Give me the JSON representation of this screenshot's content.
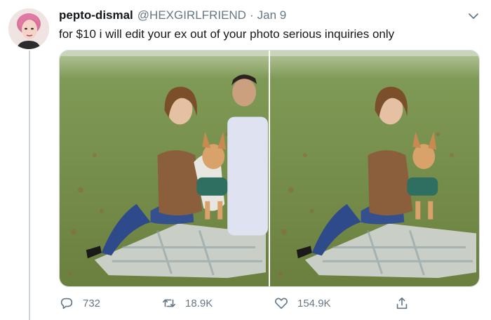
{
  "tweet": {
    "display_name": "pepto-dismal",
    "handle": "@HEXGIRLFRIEND",
    "separator": "·",
    "date": "Jan 9",
    "text": "for $10 i will edit your ex out of your photo serious inquiries only"
  },
  "media": {
    "photos": [
      {
        "label": "original photo with couple and dog"
      },
      {
        "label": "edited photo with woman and dog"
      }
    ]
  },
  "actions": {
    "reply_count": "732",
    "retweet_count": "18.9K",
    "like_count": "154.9K"
  },
  "icons": {
    "menu": "chevron-down-icon",
    "reply": "reply-icon",
    "retweet": "retweet-icon",
    "like": "heart-icon",
    "share": "share-icon"
  },
  "colors": {
    "text": "#14171a",
    "secondary": "#657786",
    "thread_line": "#ccd6dd"
  }
}
